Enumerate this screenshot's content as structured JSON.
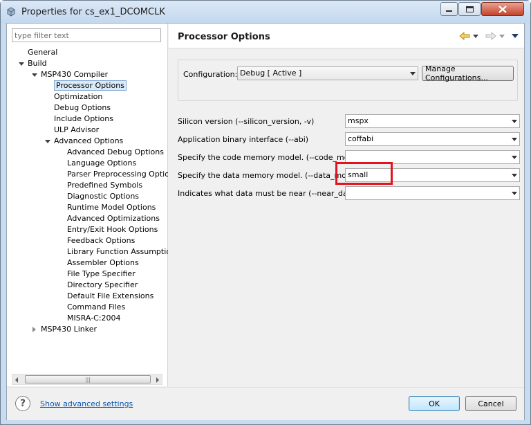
{
  "window": {
    "title": "Properties for cs_ex1_DCOMCLK"
  },
  "filter": {
    "placeholder": "type filter text"
  },
  "tree": [
    {
      "label": "General",
      "indent": 0,
      "twisty": "none"
    },
    {
      "label": "Build",
      "indent": 0,
      "twisty": "open"
    },
    {
      "label": "MSP430 Compiler",
      "indent": 1,
      "twisty": "open"
    },
    {
      "label": "Processor Options",
      "indent": 2,
      "twisty": "none",
      "selected": true
    },
    {
      "label": "Optimization",
      "indent": 2,
      "twisty": "none"
    },
    {
      "label": "Debug Options",
      "indent": 2,
      "twisty": "none"
    },
    {
      "label": "Include Options",
      "indent": 2,
      "twisty": "none"
    },
    {
      "label": "ULP Advisor",
      "indent": 2,
      "twisty": "none"
    },
    {
      "label": "Advanced Options",
      "indent": 2,
      "twisty": "open"
    },
    {
      "label": "Advanced Debug Options",
      "indent": 3,
      "twisty": "none"
    },
    {
      "label": "Language Options",
      "indent": 3,
      "twisty": "none"
    },
    {
      "label": "Parser Preprocessing Option",
      "indent": 3,
      "twisty": "none"
    },
    {
      "label": "Predefined Symbols",
      "indent": 3,
      "twisty": "none"
    },
    {
      "label": "Diagnostic Options",
      "indent": 3,
      "twisty": "none"
    },
    {
      "label": "Runtime Model Options",
      "indent": 3,
      "twisty": "none"
    },
    {
      "label": "Advanced Optimizations",
      "indent": 3,
      "twisty": "none"
    },
    {
      "label": "Entry/Exit Hook Options",
      "indent": 3,
      "twisty": "none"
    },
    {
      "label": "Feedback Options",
      "indent": 3,
      "twisty": "none"
    },
    {
      "label": "Library Function Assumption",
      "indent": 3,
      "twisty": "none"
    },
    {
      "label": "Assembler Options",
      "indent": 3,
      "twisty": "none"
    },
    {
      "label": "File Type Specifier",
      "indent": 3,
      "twisty": "none"
    },
    {
      "label": "Directory Specifier",
      "indent": 3,
      "twisty": "none"
    },
    {
      "label": "Default File Extensions",
      "indent": 3,
      "twisty": "none"
    },
    {
      "label": "Command Files",
      "indent": 3,
      "twisty": "none"
    },
    {
      "label": "MISRA-C:2004",
      "indent": 3,
      "twisty": "none"
    },
    {
      "label": "MSP430 Linker",
      "indent": 1,
      "twisty": "closed"
    }
  ],
  "page": {
    "title": "Processor Options",
    "config_label": "Configuration:",
    "config_value": "Debug  [ Active ]",
    "manage_button": "Manage Configurations...",
    "options": [
      {
        "label": "Silicon version (--silicon_version, -v)",
        "value": "mspx"
      },
      {
        "label": "Application binary interface (--abi)",
        "value": "coffabi"
      },
      {
        "label": "Specify the code memory model. (--code_model)",
        "value": ""
      },
      {
        "label": "Specify the data memory model. (--data_mode",
        "value": "small"
      },
      {
        "label": "Indicates what data must be near (--near_data)",
        "value": ""
      }
    ]
  },
  "bottom": {
    "help_glyph": "?",
    "advanced_link": "Show advanced settings",
    "ok_button": "OK",
    "cancel_button": "Cancel"
  },
  "colors": {
    "highlight_box": "#e2131f",
    "link": "#0b57b0",
    "selection": "#dbeaf9"
  },
  "icons": {
    "back": "yellow-back-arrow-icon",
    "forward": "gray-forward-arrow-icon"
  }
}
